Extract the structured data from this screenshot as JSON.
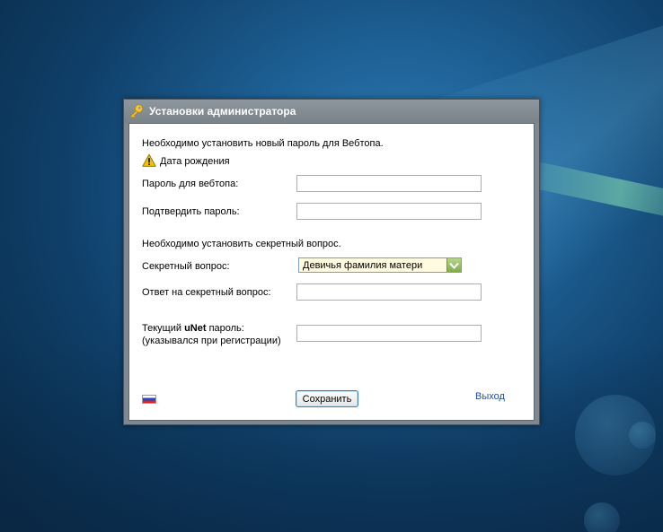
{
  "window": {
    "title": "Установки администратора"
  },
  "form": {
    "password_notice": "Необходимо установить новый пароль для Вебтопа.",
    "warning_text": "Дата рождения",
    "webtop_password_label": "Пароль для вебтопа:",
    "webtop_password_value": "",
    "confirm_password_label": "Подтвердить пароль:",
    "confirm_password_value": "",
    "secret_notice": "Необходимо установить секретный вопрос.",
    "secret_question_label": "Секретный вопрос:",
    "secret_question_selected": "Девичья фамилия матери",
    "secret_answer_label": "Ответ на секретный вопрос:",
    "secret_answer_value": "",
    "unet_label_prefix": "Текущий ",
    "unet_label_brand": "uNet",
    "unet_label_suffix": " пароль:",
    "unet_hint": "(указывался при регистрации)",
    "unet_password_value": ""
  },
  "footer": {
    "save_label": "Сохранить",
    "exit_label": "Выход"
  },
  "colors": {
    "link": "#1f4f9e",
    "warning": "#f2c200",
    "select_bg": "#fffbe0",
    "select_arrow": "#7fae4a"
  },
  "icons": {
    "title": "key-icon",
    "warning": "warning-icon",
    "language": "russian-flag-icon"
  }
}
